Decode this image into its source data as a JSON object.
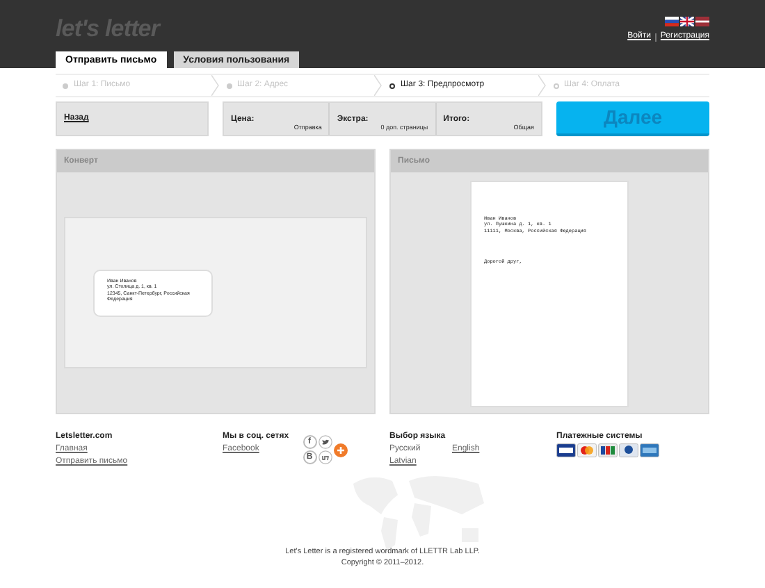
{
  "header": {
    "logo": "let's letter",
    "auth": [
      "Войти",
      "Регистрация"
    ]
  },
  "tabs": [
    {
      "label": "Отправить письмо",
      "selected": true
    },
    {
      "label": "Условия пользования",
      "selected": false
    }
  ],
  "steps": [
    {
      "label": "Шаг 1: Письмо",
      "selected": false,
      "done": true
    },
    {
      "label": "Шаг 2: Адрес",
      "selected": false,
      "done": true
    },
    {
      "label": "Шаг 3: Предпросмотр",
      "selected": true,
      "done": false
    },
    {
      "label": "Шаг 4: Оплата",
      "selected": false,
      "done": false
    }
  ],
  "back_link": "Назад",
  "totals": [
    {
      "label": "Цена:",
      "value": "Отправка"
    },
    {
      "label": "Экстра:",
      "value": "0 доп. страницы"
    },
    {
      "label": "Итого:",
      "value": "Общая"
    }
  ],
  "next_button": "Далее",
  "envelope": {
    "title": "Конверт",
    "address": [
      "Иван Иванов",
      "ул. Столица д. 1, кв. 1",
      "12345, Санкт-Петербург, Российская Федерация"
    ]
  },
  "letter": {
    "title": "Письмо",
    "address": [
      "Иван Иванов",
      "ул. Пушкина д. 1, кв. 1",
      "11111, Москва, Российская Федерация"
    ],
    "greeting": "Дорогой друг,"
  },
  "footer": {
    "site": {
      "title": "Letsletter.com",
      "links": [
        "Главная",
        "Отправить письмо"
      ]
    },
    "social": {
      "title": "Мы в соц. сетях",
      "links": [
        "Facebook"
      ],
      "icons": [
        "f",
        "В"
      ]
    },
    "language": {
      "title": "Выбор языка",
      "links": [
        "Русский",
        "English",
        "Latvian"
      ]
    },
    "payment": {
      "title": "Платежные системы"
    },
    "copyright": [
      "Let's Letter is a registered wordmark of LLETTR Lab LLP.",
      "Copyright © 2011–2012."
    ]
  }
}
